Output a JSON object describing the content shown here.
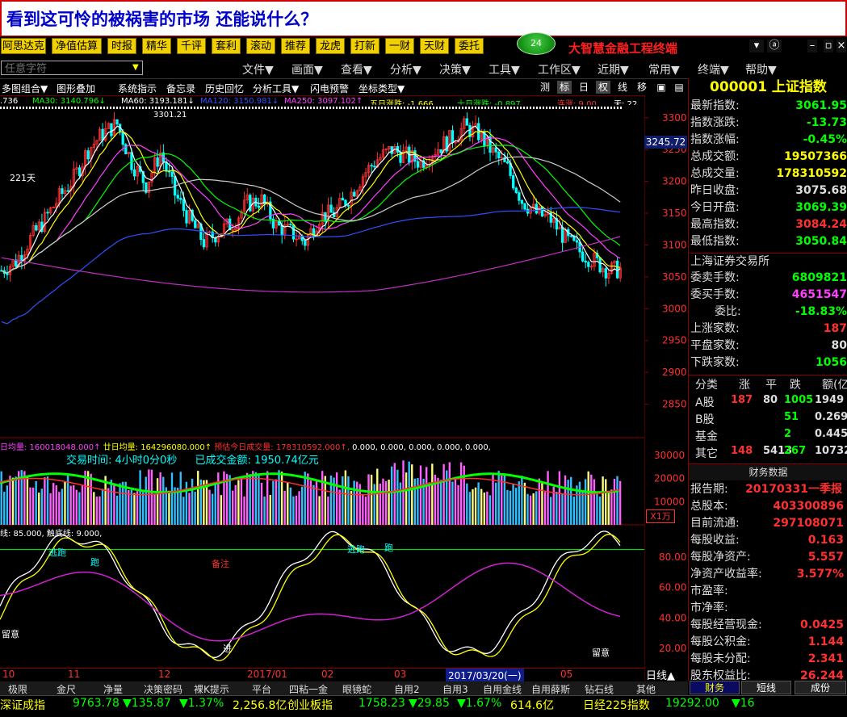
{
  "banner": {
    "text": "看到这可怜的被祸害的市场 还能说什么？"
  },
  "toolbar": {
    "buttons": [
      "阿思达克",
      "净值估算",
      "时报",
      "精华",
      "千评",
      "套利",
      "滚动",
      "推荐",
      "龙虎",
      "打新",
      "一财",
      "天财",
      "委托"
    ],
    "badge": "24",
    "app_name": "大智慧金融工程终端",
    "win_controls": [
      "▾",
      "ⓐ",
      "–",
      "▫",
      "×"
    ]
  },
  "menu": {
    "search_placeholder": "任意字符",
    "items": [
      "文件▼",
      "画面▼",
      "查看▼",
      "分析▼",
      "决策▼",
      "工具▼",
      "工作区▼",
      "近期▼",
      "常用▼",
      "终端▼",
      "帮助▼"
    ]
  },
  "chart_toolbar": {
    "items": [
      "多图组合▼",
      "图形叠加",
      "系统指示",
      "备忘录",
      "历史回忆",
      "分析工具▼",
      "闪电预警",
      "坐标类型▼"
    ],
    "right_items": [
      "测",
      "标",
      "日",
      "权",
      "线",
      "移",
      "▣",
      "▤"
    ]
  },
  "ma_legend": [
    {
      "text": ".736",
      "color": "#ffffff"
    },
    {
      "text": "MA30: 3140.796↓",
      "color": "#00ff00"
    },
    {
      "text": "MA60: 3193.181↓",
      "color": "#ffffff"
    },
    {
      "text": "MA120: 3150.981↓",
      "color": "#3050ff"
    },
    {
      "text": "MA250: 3097.102↑",
      "color": "#ff40ff"
    },
    {
      "text": "五日涨跌: -1.666",
      "color": "#ffff00"
    },
    {
      "text": "十日涨跌: -0.897",
      "color": "#00ff00"
    },
    {
      "text": "连涨: 9.00",
      "color": "#ff3030"
    },
    {
      "text": "天: 22",
      "color": "#ffffff"
    }
  ],
  "chart_labels": {
    "peak": "3301.21",
    "days": "221天",
    "price_marker": "3245.72",
    "volume_header_1": "日均量: 160018048.000↑",
    "volume_header_2": "廿日均量: 164296080.000↑",
    "volume_header_3": "预估今日成交量: 178310592.000↑,",
    "volume_header_4": "0.000, 0.000, 0.000, 0.000, 0.000,",
    "trade_time": "交易时间: 4小时0分0秒",
    "trade_amount": "已成交金额: 1950.74亿元",
    "volume_unit": "X1万",
    "osc_header": "线: 85.000, 触底线: 9.000,",
    "osc_tags": [
      "逃跑",
      "跑",
      "备注",
      "逃跑",
      "跑",
      "进",
      "留意",
      "留意"
    ],
    "x_labels": [
      "10",
      "11",
      "12",
      "2017/01",
      "02",
      "03",
      "2017/03/20(一)",
      "05"
    ],
    "bottom_axis_tag": "日线▲"
  },
  "chart_data": [
    {
      "type": "candlestick",
      "ylim": [
        2800,
        3320
      ],
      "yticks": [
        3300,
        3250,
        3200,
        3150,
        3100,
        3050,
        3000,
        2950,
        2900,
        2850
      ],
      "series": [
        {
          "name": "close",
          "values": [
            3060,
            3075,
            3110,
            3140,
            3175,
            3205,
            3250,
            3275,
            3290,
            3230,
            3195,
            3245,
            3180,
            3140,
            3105,
            3120,
            3135,
            3165,
            3170,
            3130,
            3120,
            3105,
            3145,
            3150,
            3175,
            3210,
            3235,
            3250,
            3240,
            3230,
            3250,
            3265,
            3285,
            3275,
            3245,
            3220,
            3170,
            3150,
            3140,
            3110,
            3090,
            3075,
            3060,
            3062
          ]
        }
      ]
    },
    {
      "type": "bar",
      "name": "volume",
      "ylim": [
        0,
        32000
      ],
      "yticks": [
        30000,
        20000,
        10000
      ]
    },
    {
      "type": "line",
      "name": "oscillator",
      "ylim": [
        10,
        100
      ],
      "yticks": [
        80,
        60,
        40,
        20
      ]
    }
  ],
  "info_panel": {
    "title": "000001 上证指数",
    "rows": [
      {
        "label": "最新指数:",
        "value": "3061.95",
        "color": "#00ff00"
      },
      {
        "label": "指数涨跌:",
        "value": "-13.73",
        "color": "#00ff00"
      },
      {
        "label": "指数涨幅:",
        "value": "-0.45%",
        "color": "#00ff00"
      },
      {
        "label": "总成交额:",
        "value": "19507366",
        "color": "#ffff00"
      },
      {
        "label": "总成交量:",
        "value": "178310592",
        "color": "#ffff00"
      },
      {
        "label": "昨日收盘:",
        "value": "3075.68",
        "color": "#dddddd"
      },
      {
        "label": "今日开盘:",
        "value": "3069.39",
        "color": "#00ff00"
      },
      {
        "label": "最高指数:",
        "value": "3084.24",
        "color": "#ff3030"
      },
      {
        "label": "最低指数:",
        "value": "3050.84",
        "color": "#00ff00"
      }
    ],
    "exchange": "上海证券交易所",
    "rows2": [
      {
        "label": "委卖手数:",
        "value": "6809821",
        "color": "#00ff00"
      },
      {
        "label": "委买手数:",
        "value": "4651547",
        "color": "#ff40ff"
      },
      {
        "label": "委比:",
        "value": "-18.83%",
        "color": "#00ff00"
      },
      {
        "label": "上涨家数:",
        "value": "187",
        "color": "#ff3030"
      },
      {
        "label": "平盘家数:",
        "value": "80",
        "color": "#dddddd"
      },
      {
        "label": "下跌家数:",
        "value": "1056",
        "color": "#00ff00"
      }
    ],
    "cat_header": [
      "分类",
      "涨",
      "平",
      "跌",
      "额(亿"
    ],
    "cats": [
      {
        "name": "A股",
        "up": "187",
        "flat": "80",
        "down": "1005",
        "amt": "1949"
      },
      {
        "name": "B股",
        "up": "",
        "flat": "",
        "down": "51",
        "amt": "0.269"
      },
      {
        "name": "基金",
        "up": "",
        "flat": "",
        "down": "2",
        "amt": "0.445"
      },
      {
        "name": "其它",
        "up": "148",
        "flat": "5413",
        "down": "267",
        "amt": "10732"
      }
    ],
    "fin_title": "财务数据",
    "fin_rows": [
      {
        "label": "报告期:",
        "value": "20170331一季报"
      },
      {
        "label": "总股本:",
        "value": "403300896"
      },
      {
        "label": "目前流通:",
        "value": "297108071"
      },
      {
        "label": "每股收益:",
        "value": "0.163"
      },
      {
        "label": "每股净资产:",
        "value": "5.557"
      },
      {
        "label": "净资产收益率:",
        "value": "3.577%"
      },
      {
        "label": "市盈率:",
        "value": ""
      },
      {
        "label": "市净率:",
        "value": ""
      },
      {
        "label": "每股经营现金:",
        "value": "0.0425"
      },
      {
        "label": "每股公积金:",
        "value": "1.144"
      },
      {
        "label": "每股未分配:",
        "value": "2.341"
      },
      {
        "label": "股东权益比:",
        "value": "26.244"
      }
    ],
    "tabs": [
      "财务",
      "短线",
      "成份"
    ]
  },
  "bottom_tabs": [
    "极限",
    "金尺",
    "净量",
    "决策密码",
    "裸K提示",
    "平台",
    "四粘一金",
    "眼镜蛇",
    "自用2",
    "自用3",
    "自用金线",
    "自用薛斯",
    "钻石线",
    "其他"
  ],
  "ticker": [
    {
      "text": "深证成指",
      "color": "#ffff00"
    },
    {
      "text": "9763.78",
      "color": "#00ff00"
    },
    {
      "text": "▼135.87",
      "color": "#00ff00"
    },
    {
      "text": "▼1.37%",
      "color": "#00ff00"
    },
    {
      "text": "2,256.8亿",
      "color": "#ffff00"
    },
    {
      "text": "创业板指",
      "color": "#ffff00"
    },
    {
      "text": "1758.23",
      "color": "#00ff00"
    },
    {
      "text": "▼29.85",
      "color": "#00ff00"
    },
    {
      "text": "▼1.67%",
      "color": "#00ff00"
    },
    {
      "text": "614.6亿",
      "color": "#ffff00"
    },
    {
      "text": "日经225指数",
      "color": "#ffff00"
    },
    {
      "text": "19292.00",
      "color": "#00ff00"
    },
    {
      "text": "▼16",
      "color": "#00ff00"
    }
  ]
}
